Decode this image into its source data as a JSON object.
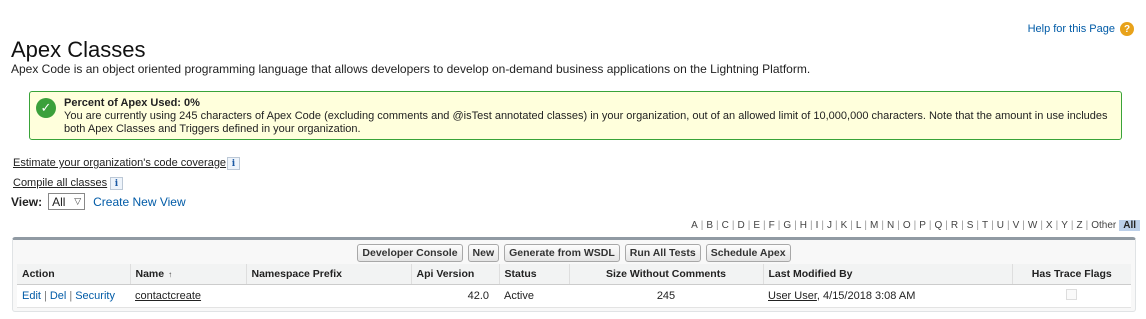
{
  "header": {
    "title": "Apex Classes",
    "help_label": "Help for this Page",
    "help_icon": "?"
  },
  "description": "Apex Code is an object oriented programming language that allows developers to develop on-demand business applications on the Lightning Platform.",
  "usage": {
    "title": "Percent of Apex Used: 0%",
    "line1": "You are currently using 245 characters of Apex Code (excluding comments and @isTest annotated classes) in your organization, out of an allowed limit of 10,000,000 characters. Note that the amount in use includes",
    "line2": "both Apex Classes and Triggers defined in your organization.",
    "icon": "check-icon"
  },
  "links": {
    "coverage": "Estimate your organization's code coverage",
    "compile": "Compile all classes",
    "info_glyph": "i"
  },
  "view": {
    "label": "View:",
    "selected": "All",
    "create_new": "Create New View"
  },
  "alphabet": [
    "A",
    "B",
    "C",
    "D",
    "E",
    "F",
    "G",
    "H",
    "I",
    "J",
    "K",
    "L",
    "M",
    "N",
    "O",
    "P",
    "Q",
    "R",
    "S",
    "T",
    "U",
    "V",
    "W",
    "X",
    "Y",
    "Z",
    "Other",
    "All"
  ],
  "buttons": {
    "developer_console": "Developer Console",
    "new": "New",
    "generate_wsdl": "Generate from WSDL",
    "run_all_tests": "Run All Tests",
    "schedule_apex": "Schedule Apex"
  },
  "table": {
    "columns": {
      "action": "Action",
      "name": "Name",
      "namespace": "Namespace Prefix",
      "api_version": "Api Version",
      "status": "Status",
      "size": "Size Without Comments",
      "last_modified": "Last Modified By",
      "trace_flags": "Has Trace Flags"
    },
    "sort_icon": "↑",
    "rows": [
      {
        "edit": "Edit",
        "del": "Del",
        "security": "Security",
        "name": "contactcreate",
        "namespace": "",
        "api_version": "42.0",
        "status": "Active",
        "size": "245",
        "modified_user": "User User",
        "modified_date": ", 4/15/2018 3:08 AM",
        "has_trace_flags": false
      }
    ]
  },
  "colors": {
    "link": "#015ba7",
    "success": "#3ba03b",
    "info_bg": "#ffffdc",
    "help_icon": "#e8a21a"
  }
}
